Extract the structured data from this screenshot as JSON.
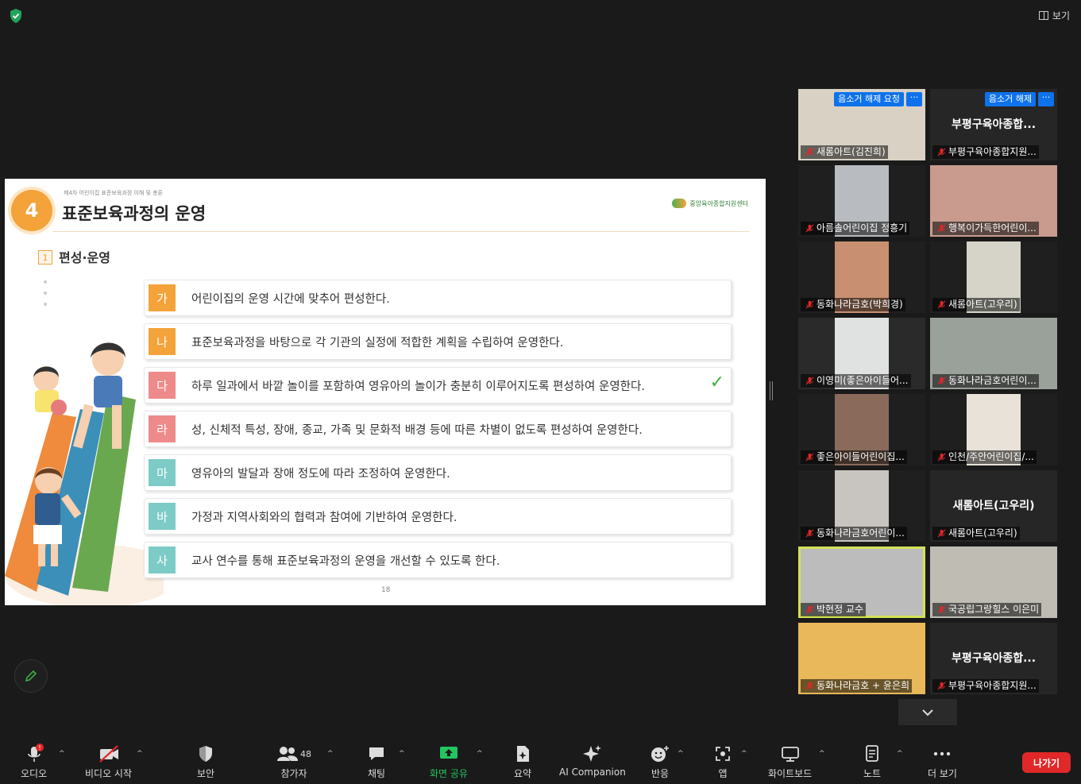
{
  "window": {
    "view_label": "보기"
  },
  "slide": {
    "chapter_num": "4",
    "chapter_sub": "제4차 어린이집 표준보육과정 이해 및 총론",
    "title": "표준보육과정의 운영",
    "logo": "중앙육아종합지원센터",
    "section_num": "1",
    "section_title": "편성·운영",
    "page": "18",
    "items": [
      {
        "badge": "가",
        "text": "어린이집의 운영 시간에 맞추어 편성한다.",
        "color": "#f3a33a"
      },
      {
        "badge": "나",
        "text": "표준보육과정을 바탕으로 각 기관의 실정에 적합한 계획을 수립하여 운영한다.",
        "color": "#f3a33a"
      },
      {
        "badge": "다",
        "text": "하루 일과에서 바깥 놀이를 포함하여 영유아의 놀이가 충분히 이루어지도록 편성하여 운영한다.",
        "color": "#ee8a8a"
      },
      {
        "badge": "라",
        "text": "성, 신체적 특성, 장애, 종교, 가족 및 문화적 배경 등에 따른 차별이 없도록 편성하여 운영한다.",
        "color": "#ee8a8a"
      },
      {
        "badge": "마",
        "text": "영유아의 발달과 장애 정도에 따라 조정하여 운영한다.",
        "color": "#7ccbc6"
      },
      {
        "badge": "바",
        "text": "가정과 지역사회와의 협력과 참여에 기반하여 운영한다.",
        "color": "#7ccbc6"
      },
      {
        "badge": "사",
        "text": "교사 연수를 통해 표준보육과정의 운영을 개선할 수 있도록 한다.",
        "color": "#7ccbc6"
      }
    ]
  },
  "gallery": {
    "unmute_request": "음소거 해제 요청",
    "unmute": "음소거 해제",
    "more": "···",
    "tiles": [
      {
        "name": "새롬아트(김진희)"
      },
      {
        "name": "부평구육아종합지원...",
        "big": "부평구육아종합..."
      },
      {
        "name": "아름솔어린이집 정흥기"
      },
      {
        "name": "행복이가득한어린이..."
      },
      {
        "name": "동화나라금호(박희경)"
      },
      {
        "name": "새롬아트(고우리)"
      },
      {
        "name": "이영미(좋은아이들어..."
      },
      {
        "name": "동화나라금호어린이..."
      },
      {
        "name": "좋은아이들어린이집..."
      },
      {
        "name": "인천/주안어린이집/..."
      },
      {
        "name": "동화나라금호어린이..."
      },
      {
        "name": "새롬아트(고우리)",
        "big": "새롬아트(고우리)"
      },
      {
        "name": "박현정 교수"
      },
      {
        "name": "국공립그랑힐스 이은미"
      },
      {
        "name": "동화나라금호 + 윤은희"
      },
      {
        "name": "부평구육아종합지원...",
        "big": "부평구육아종합..."
      }
    ]
  },
  "toolbar": {
    "audio": "오디오",
    "video": "비디오 시작",
    "security": "보안",
    "participants": "참가자",
    "participants_count": "48",
    "chat": "채팅",
    "share": "화면 공유",
    "summary": "요약",
    "ai": "AI Companion",
    "reactions": "반응",
    "apps": "앱",
    "whiteboard": "화이트보드",
    "notes": "노트",
    "more": "더 보기",
    "leave": "나가기",
    "share_color": "#22c55e",
    "leave_color": "#e02828"
  }
}
